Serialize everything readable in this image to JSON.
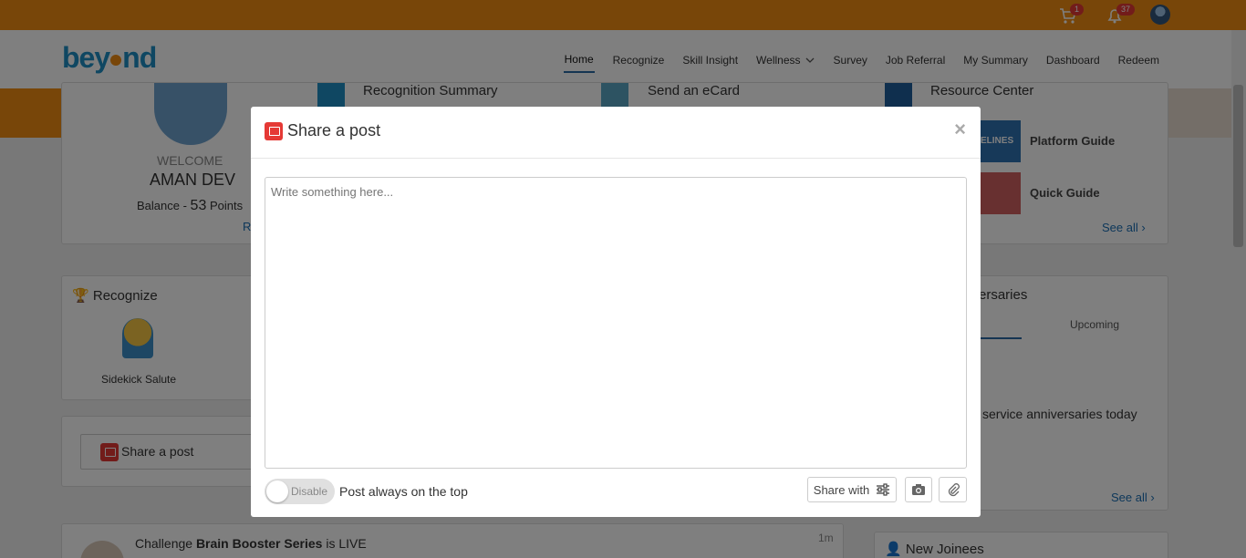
{
  "topbar": {
    "cart_count": "1",
    "notification_count": "37"
  },
  "logo_text": {
    "pre": "bey",
    "post": "nd"
  },
  "nav": {
    "items": [
      "Home",
      "Recognize",
      "Skill Insight",
      "Wellness",
      "Survey",
      "Job Referral",
      "My Summary",
      "Dashboard",
      "Redeem"
    ]
  },
  "profile": {
    "welcome": "WELCOME",
    "name": "AMAN DEV",
    "balance_label": "Balance - ",
    "balance_value": "53",
    "balance_unit": " Points",
    "link_fragment": "R"
  },
  "quick_links": {
    "recognition_summary": "Recognition Summary",
    "send_ecard": "Send an eCard",
    "resource_center": "Resource Center",
    "platform_guide": "Platform Guide",
    "quick_guide": "Quick Guide",
    "see_all": "See all ›",
    "banner_fragment": "ELINES"
  },
  "recognize_card": {
    "title": "Recognize",
    "badge_label": "Sidekick Salute"
  },
  "share_card": {
    "label": "Share a post"
  },
  "anniversaries": {
    "title_fragment": "ersaries",
    "tab_upcoming": "Upcoming",
    "empty_fragment": "service anniversaries today",
    "see_all": "See all ›"
  },
  "feed": {
    "prefix": "Challenge ",
    "challenge_name": "Brain Booster Series",
    "suffix": " is LIVE",
    "time": "1m"
  },
  "new_joinees": {
    "title": "New Joinees"
  },
  "modal": {
    "title": "Share a post",
    "close_label": "×",
    "textarea_placeholder": "Write something here...",
    "toggle_label": "Disable",
    "pin_label": "Post always on the top",
    "share_with_label": "Share with"
  }
}
